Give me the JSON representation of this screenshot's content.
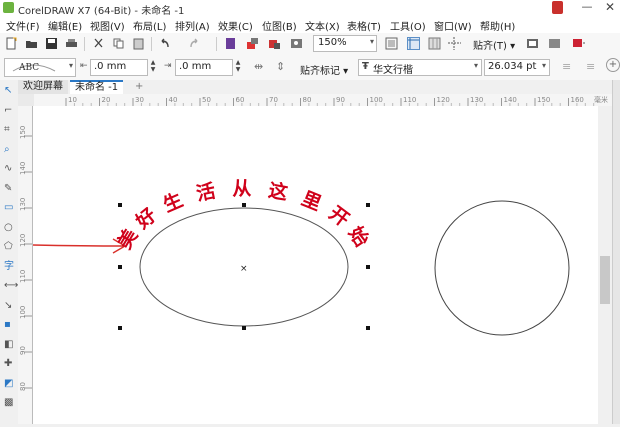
{
  "window": {
    "title": "CorelDRAW X7 (64-Bit) - 未命名 -1",
    "minimize": "—",
    "close": "✕"
  },
  "menu": [
    "文件(F)",
    "编辑(E)",
    "视图(V)",
    "布局(L)",
    "排列(A)",
    "效果(C)",
    "位图(B)",
    "文本(X)",
    "表格(T)",
    "工具(O)",
    "窗口(W)",
    "帮助(H)"
  ],
  "toolbar": {
    "zoom_value": "150%",
    "snap_label": "贴齐(T) ▾"
  },
  "propbar": {
    "offset_x": ".0 mm",
    "offset_y": ".0 mm",
    "snap_marks": "贴齐标记 ▾",
    "font_name": "华文行楷",
    "font_size": "26.034 pt"
  },
  "tabs": {
    "welcome": "欢迎屏幕",
    "document": "未命名 -1",
    "add": "+"
  },
  "ruler": {
    "h_ticks": [
      "10",
      "20",
      "30",
      "40",
      "50",
      "60",
      "70",
      "80",
      "90",
      "100",
      "110",
      "120",
      "130",
      "140",
      "150",
      "160"
    ],
    "unit": "毫米",
    "v_ticks": [
      "150",
      "140",
      "130",
      "120",
      "110",
      "100",
      "90",
      "80"
    ]
  },
  "canvas": {
    "arc_text": [
      "美",
      "好",
      "生",
      "活",
      "从",
      "这",
      "里",
      "开",
      "始"
    ],
    "text_color": "#d0021b",
    "arrow_color": "#d9302b"
  },
  "toolbox_icons": [
    "pick-tool-icon",
    "shape-tool-icon",
    "crop-tool-icon",
    "zoom-tool-icon",
    "freehand-tool-icon",
    "artistic-media-icon",
    "rectangle-tool-icon",
    "ellipse-tool-icon",
    "polygon-tool-icon",
    "text-tool-icon",
    "parallel-dimension-icon",
    "connector-tool-icon",
    "drop-shadow-icon",
    "transparency-icon",
    "eyedropper-icon",
    "interactive-fill-icon",
    "smart-fill-icon"
  ]
}
